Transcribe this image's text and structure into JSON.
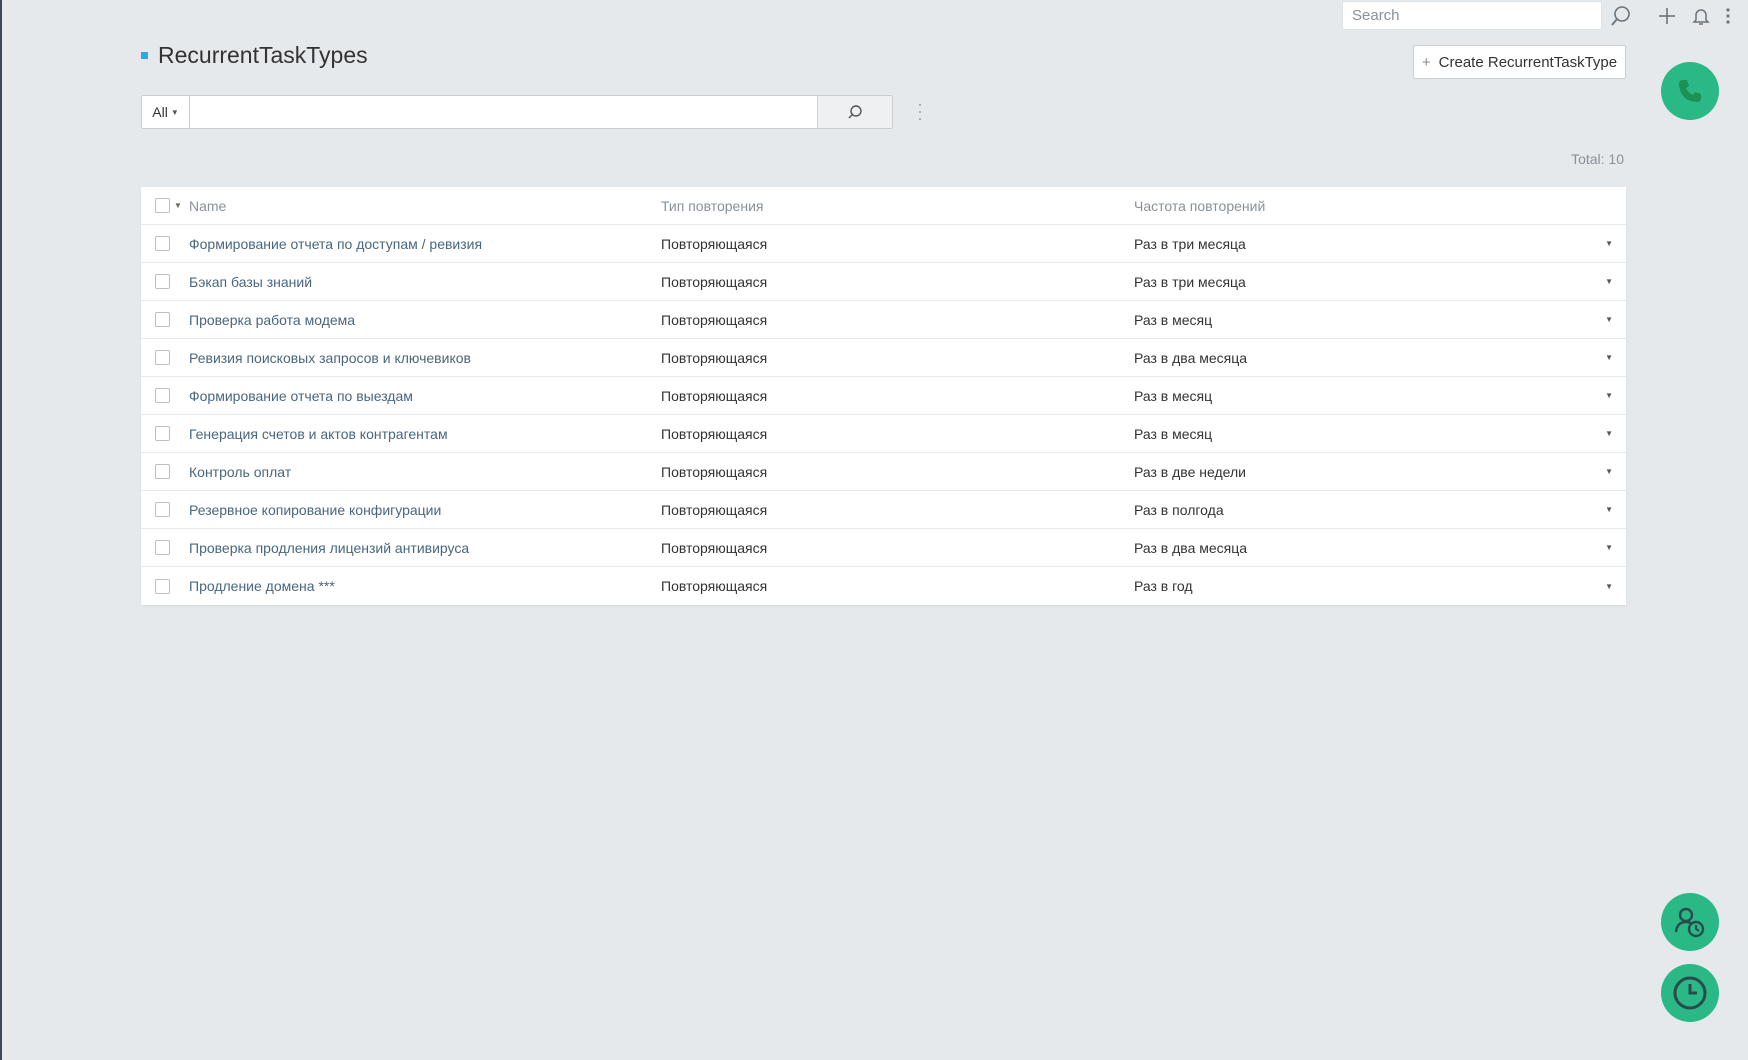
{
  "topbar": {
    "search_placeholder": "Search",
    "icons": [
      "search-icon",
      "plus-icon",
      "bell-icon",
      "kebab-menu-icon"
    ]
  },
  "header": {
    "title": "RecurrentTaskTypes",
    "create_label": "Create RecurrentTaskType"
  },
  "filter": {
    "select_value": "All",
    "input_value": "",
    "total_label": "Total:",
    "total_value": "10"
  },
  "table": {
    "columns": [
      "Name",
      "Тип повторения",
      "Частота повторений"
    ],
    "rows": [
      {
        "name": "Формирование отчета по доступам / ревизия",
        "type": "Повторяющаяся",
        "freq": "Раз в три месяца"
      },
      {
        "name": "Бэкап базы знаний",
        "type": "Повторяющаяся",
        "freq": "Раз в три месяца"
      },
      {
        "name": "Проверка работа модема",
        "type": "Повторяющаяся",
        "freq": "Раз в месяц"
      },
      {
        "name": "Ревизия поисковых запросов и ключевиков",
        "type": "Повторяющаяся",
        "freq": "Раз в два месяца"
      },
      {
        "name": "Формирование отчета по выездам",
        "type": "Повторяющаяся",
        "freq": "Раз в месяц"
      },
      {
        "name": "Генерация счетов и актов контрагентам",
        "type": "Повторяющаяся",
        "freq": "Раз в месяц"
      },
      {
        "name": "Контроль оплат",
        "type": "Повторяющаяся",
        "freq": "Раз в две недели"
      },
      {
        "name": "Резервное копирование конфигурации",
        "type": "Повторяющаяся",
        "freq": "Раз в полгода"
      },
      {
        "name": "Проверка продления лицензий антивируса",
        "type": "Повторяющаяся",
        "freq": "Раз в два месяца"
      },
      {
        "name": "Продление домена ***",
        "type": "Повторяющаяся",
        "freq": "Раз в год"
      }
    ]
  },
  "colors": {
    "accent": "#2bb887",
    "title_bullet": "#2ea9e0",
    "link": "#48677e",
    "background": "#e5e9ec"
  },
  "fabs": [
    "phone-icon",
    "users-icon",
    "clock-icon"
  ]
}
